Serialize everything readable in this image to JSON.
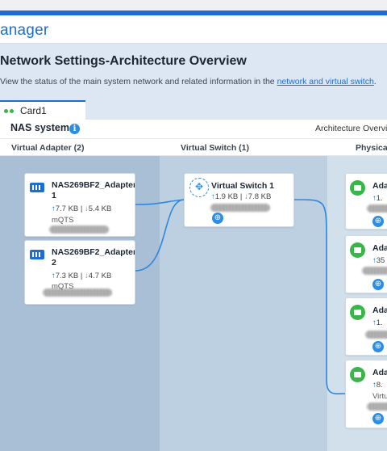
{
  "app": {
    "title": "anager"
  },
  "page": {
    "title": "Network Settings-Architecture Overview",
    "description_prefix": "View the status of the main system network and related information in the ",
    "description_link": "network and virtual switch",
    "description_suffix": "."
  },
  "tab": {
    "label": "Card1"
  },
  "system": {
    "name": "NAS system",
    "info_icon": "i",
    "arch_label": "Architecture Overvie"
  },
  "columns": [
    {
      "label": "Virtual Adapter (2)"
    },
    {
      "label": "Virtual Switch (1)"
    },
    {
      "label": "Physical"
    }
  ],
  "adapters": [
    {
      "name": "NAS269BF2_Adapter 1",
      "up": "7.7 KB",
      "down": "5.4 KB",
      "sub": "mQTS"
    },
    {
      "name": "NAS269BF2_Adapter 2",
      "up": "7.3 KB",
      "down": "4.7 KB",
      "sub": "mQTS"
    }
  ],
  "switch": {
    "name": "Virtual Switch 1",
    "up": "1.9 KB",
    "down": "7.8 KB"
  },
  "physical": [
    {
      "name": "Ada",
      "up": "1.",
      "sub": ""
    },
    {
      "name": "Ada",
      "up": "35",
      "sub": ""
    },
    {
      "name": "Ada",
      "up": "1.",
      "sub": ""
    },
    {
      "name": "Ada",
      "up": "8.",
      "sub": "Virtu"
    }
  ],
  "labels": {
    "separator": "|"
  },
  "colors": {
    "accent": "#1b6fd1",
    "green": "#3ab54a",
    "link_line": "#2f86e0"
  }
}
